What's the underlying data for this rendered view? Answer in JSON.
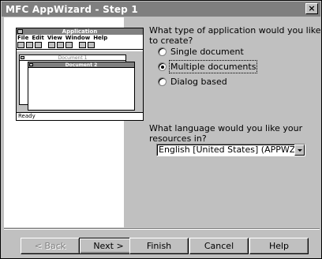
{
  "window": {
    "title": "MFC AppWizard - Step 1",
    "close_glyph": "×"
  },
  "illustration": {
    "app_title": "Application",
    "menu": [
      "File",
      "Edit",
      "View",
      "Window",
      "Help"
    ],
    "doc1_title": "Document 1",
    "doc2_title": "Document 2",
    "status": "Ready"
  },
  "question1": "What type of application would you like to create?",
  "app_types": [
    {
      "label": "Single document",
      "selected": false
    },
    {
      "label": "Multiple documents",
      "selected": true
    },
    {
      "label": "Dialog based",
      "selected": false
    }
  ],
  "question2": "What language would you like your resources in?",
  "language": "English [United States] (APPWZENU.DLL)",
  "buttons": {
    "back": "< Back",
    "next": "Next >",
    "finish": "Finish",
    "cancel": "Cancel",
    "help": "Help"
  }
}
